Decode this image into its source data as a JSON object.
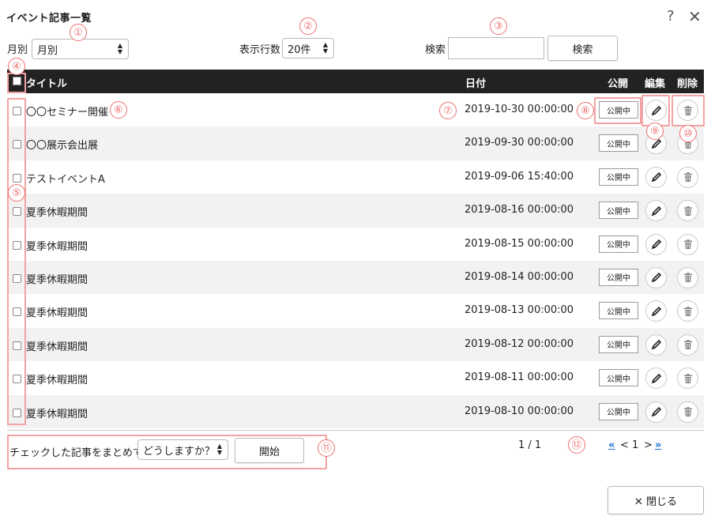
{
  "window": {
    "title": "イベント記事一覧",
    "help_label": "?",
    "close_label": "✕"
  },
  "filters": {
    "month_label": "月別",
    "month_value": "月別",
    "rows_label": "表示行数",
    "rows_value": "20件",
    "search_label": "検索",
    "search_value": "",
    "search_button": "検索"
  },
  "table": {
    "columns": {
      "title": "タイトル",
      "date": "日付",
      "public": "公開",
      "edit": "編集",
      "delete": "削除"
    },
    "rows": [
      {
        "title": "〇〇セミナー開催",
        "date": "2019-10-30 00:00:00",
        "status": "公開中"
      },
      {
        "title": "〇〇展示会出展",
        "date": "2019-09-30 00:00:00",
        "status": "公開中"
      },
      {
        "title": "テストイベントA",
        "date": "2019-09-06 15:40:00",
        "status": "公開中"
      },
      {
        "title": "夏季休暇期間",
        "date": "2019-08-16 00:00:00",
        "status": "公開中"
      },
      {
        "title": "夏季休暇期間",
        "date": "2019-08-15 00:00:00",
        "status": "公開中"
      },
      {
        "title": "夏季休暇期間",
        "date": "2019-08-14 00:00:00",
        "status": "公開中"
      },
      {
        "title": "夏季休暇期間",
        "date": "2019-08-13 00:00:00",
        "status": "公開中"
      },
      {
        "title": "夏季休暇期間",
        "date": "2019-08-12 00:00:00",
        "status": "公開中"
      },
      {
        "title": "夏季休暇期間",
        "date": "2019-08-11 00:00:00",
        "status": "公開中"
      },
      {
        "title": "夏季休暇期間",
        "date": "2019-08-10 00:00:00",
        "status": "公開中"
      }
    ]
  },
  "bulk": {
    "label": "チェックした記事をまとめて",
    "select_value": "どうしますか？",
    "start_button": "開始"
  },
  "pagination": {
    "info": "1 / 1",
    "first": "«",
    "prev": "<",
    "current": "1",
    "next": ">",
    "last": "»"
  },
  "footer": {
    "close_button": "✕ 閉じる"
  },
  "annotations": [
    "①",
    "②",
    "③",
    "④",
    "⑤",
    "⑥",
    "⑦",
    "⑧",
    "⑨",
    "⑩",
    "⑪",
    "⑫"
  ],
  "colors": {
    "header_bg": "#222222",
    "annotation": "#ef6e6e",
    "link": "#1a6fd4",
    "row_alt": "#f2f2f2"
  }
}
